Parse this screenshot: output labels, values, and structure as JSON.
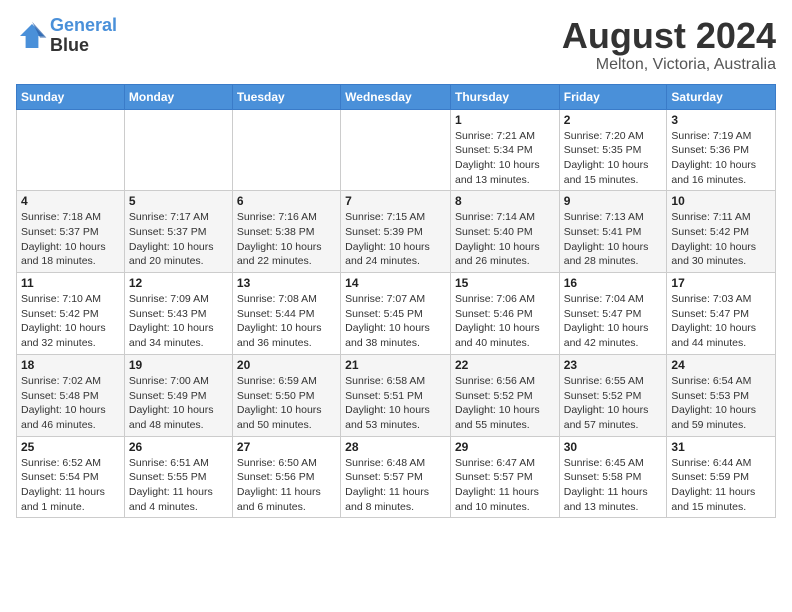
{
  "header": {
    "logo_line1": "General",
    "logo_line2": "Blue",
    "title": "August 2024",
    "location": "Melton, Victoria, Australia"
  },
  "weekdays": [
    "Sunday",
    "Monday",
    "Tuesday",
    "Wednesday",
    "Thursday",
    "Friday",
    "Saturday"
  ],
  "weeks": [
    [
      {
        "day": "",
        "info": ""
      },
      {
        "day": "",
        "info": ""
      },
      {
        "day": "",
        "info": ""
      },
      {
        "day": "",
        "info": ""
      },
      {
        "day": "1",
        "info": "Sunrise: 7:21 AM\nSunset: 5:34 PM\nDaylight: 10 hours\nand 13 minutes."
      },
      {
        "day": "2",
        "info": "Sunrise: 7:20 AM\nSunset: 5:35 PM\nDaylight: 10 hours\nand 15 minutes."
      },
      {
        "day": "3",
        "info": "Sunrise: 7:19 AM\nSunset: 5:36 PM\nDaylight: 10 hours\nand 16 minutes."
      }
    ],
    [
      {
        "day": "4",
        "info": "Sunrise: 7:18 AM\nSunset: 5:37 PM\nDaylight: 10 hours\nand 18 minutes."
      },
      {
        "day": "5",
        "info": "Sunrise: 7:17 AM\nSunset: 5:37 PM\nDaylight: 10 hours\nand 20 minutes."
      },
      {
        "day": "6",
        "info": "Sunrise: 7:16 AM\nSunset: 5:38 PM\nDaylight: 10 hours\nand 22 minutes."
      },
      {
        "day": "7",
        "info": "Sunrise: 7:15 AM\nSunset: 5:39 PM\nDaylight: 10 hours\nand 24 minutes."
      },
      {
        "day": "8",
        "info": "Sunrise: 7:14 AM\nSunset: 5:40 PM\nDaylight: 10 hours\nand 26 minutes."
      },
      {
        "day": "9",
        "info": "Sunrise: 7:13 AM\nSunset: 5:41 PM\nDaylight: 10 hours\nand 28 minutes."
      },
      {
        "day": "10",
        "info": "Sunrise: 7:11 AM\nSunset: 5:42 PM\nDaylight: 10 hours\nand 30 minutes."
      }
    ],
    [
      {
        "day": "11",
        "info": "Sunrise: 7:10 AM\nSunset: 5:42 PM\nDaylight: 10 hours\nand 32 minutes."
      },
      {
        "day": "12",
        "info": "Sunrise: 7:09 AM\nSunset: 5:43 PM\nDaylight: 10 hours\nand 34 minutes."
      },
      {
        "day": "13",
        "info": "Sunrise: 7:08 AM\nSunset: 5:44 PM\nDaylight: 10 hours\nand 36 minutes."
      },
      {
        "day": "14",
        "info": "Sunrise: 7:07 AM\nSunset: 5:45 PM\nDaylight: 10 hours\nand 38 minutes."
      },
      {
        "day": "15",
        "info": "Sunrise: 7:06 AM\nSunset: 5:46 PM\nDaylight: 10 hours\nand 40 minutes."
      },
      {
        "day": "16",
        "info": "Sunrise: 7:04 AM\nSunset: 5:47 PM\nDaylight: 10 hours\nand 42 minutes."
      },
      {
        "day": "17",
        "info": "Sunrise: 7:03 AM\nSunset: 5:47 PM\nDaylight: 10 hours\nand 44 minutes."
      }
    ],
    [
      {
        "day": "18",
        "info": "Sunrise: 7:02 AM\nSunset: 5:48 PM\nDaylight: 10 hours\nand 46 minutes."
      },
      {
        "day": "19",
        "info": "Sunrise: 7:00 AM\nSunset: 5:49 PM\nDaylight: 10 hours\nand 48 minutes."
      },
      {
        "day": "20",
        "info": "Sunrise: 6:59 AM\nSunset: 5:50 PM\nDaylight: 10 hours\nand 50 minutes."
      },
      {
        "day": "21",
        "info": "Sunrise: 6:58 AM\nSunset: 5:51 PM\nDaylight: 10 hours\nand 53 minutes."
      },
      {
        "day": "22",
        "info": "Sunrise: 6:56 AM\nSunset: 5:52 PM\nDaylight: 10 hours\nand 55 minutes."
      },
      {
        "day": "23",
        "info": "Sunrise: 6:55 AM\nSunset: 5:52 PM\nDaylight: 10 hours\nand 57 minutes."
      },
      {
        "day": "24",
        "info": "Sunrise: 6:54 AM\nSunset: 5:53 PM\nDaylight: 10 hours\nand 59 minutes."
      }
    ],
    [
      {
        "day": "25",
        "info": "Sunrise: 6:52 AM\nSunset: 5:54 PM\nDaylight: 11 hours\nand 1 minute."
      },
      {
        "day": "26",
        "info": "Sunrise: 6:51 AM\nSunset: 5:55 PM\nDaylight: 11 hours\nand 4 minutes."
      },
      {
        "day": "27",
        "info": "Sunrise: 6:50 AM\nSunset: 5:56 PM\nDaylight: 11 hours\nand 6 minutes."
      },
      {
        "day": "28",
        "info": "Sunrise: 6:48 AM\nSunset: 5:57 PM\nDaylight: 11 hours\nand 8 minutes."
      },
      {
        "day": "29",
        "info": "Sunrise: 6:47 AM\nSunset: 5:57 PM\nDaylight: 11 hours\nand 10 minutes."
      },
      {
        "day": "30",
        "info": "Sunrise: 6:45 AM\nSunset: 5:58 PM\nDaylight: 11 hours\nand 13 minutes."
      },
      {
        "day": "31",
        "info": "Sunrise: 6:44 AM\nSunset: 5:59 PM\nDaylight: 11 hours\nand 15 minutes."
      }
    ]
  ]
}
